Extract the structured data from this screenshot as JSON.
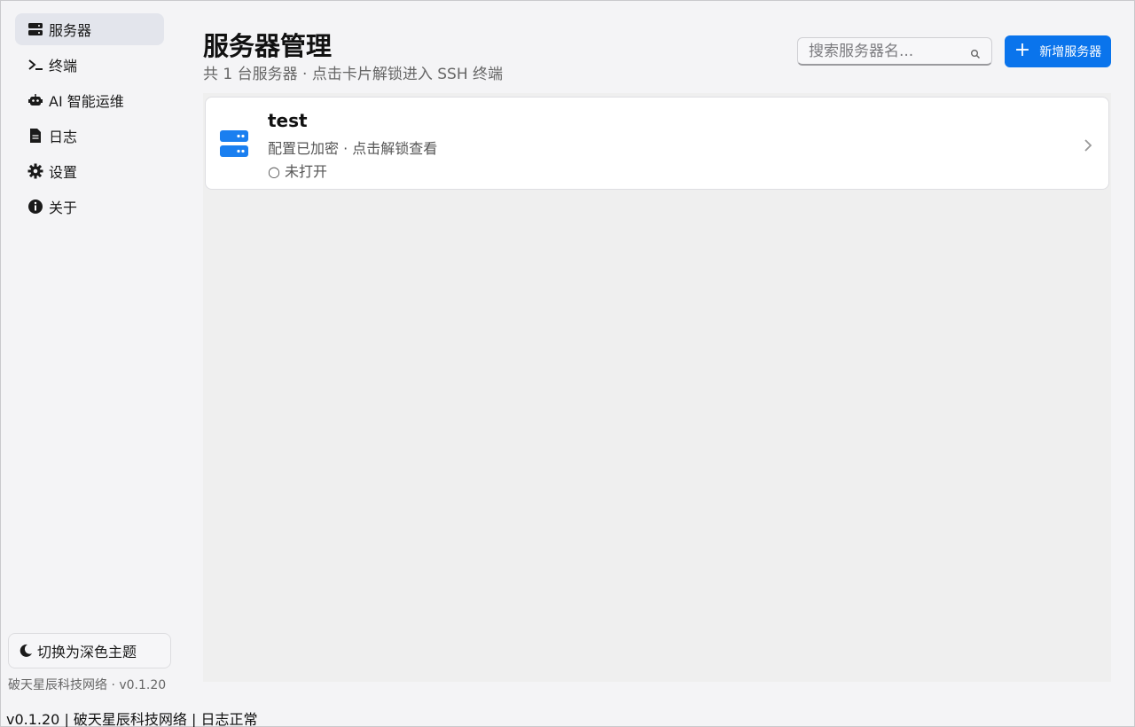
{
  "sidebar": {
    "items": [
      {
        "label": "服务器",
        "icon": "server-icon",
        "active": true
      },
      {
        "label": "终端",
        "icon": "terminal-icon",
        "active": false
      },
      {
        "label": "AI 智能运维",
        "icon": "robot-icon",
        "active": false
      },
      {
        "label": "日志",
        "icon": "file-icon",
        "active": false
      },
      {
        "label": "设置",
        "icon": "gear-icon",
        "active": false
      },
      {
        "label": "关于",
        "icon": "info-icon",
        "active": false
      }
    ],
    "theme_toggle": "切换为深色主题",
    "brand": "破天星辰科技网络 · v0.1.20"
  },
  "header": {
    "title": "服务器管理",
    "subtitle": "共 1 台服务器 · 点击卡片解锁进入 SSH 终端",
    "search_placeholder": "搜索服务器名...",
    "add_button": "新增服务器"
  },
  "servers": [
    {
      "name": "test",
      "desc": "配置已加密 · 点击解锁查看",
      "status": "○ 未打开"
    }
  ],
  "statusbar": "v0.1.20 | 破天星辰科技网络 | 日志正常",
  "colors": {
    "accent": "#0a74ec",
    "server_icon": "#1a7ff0"
  }
}
